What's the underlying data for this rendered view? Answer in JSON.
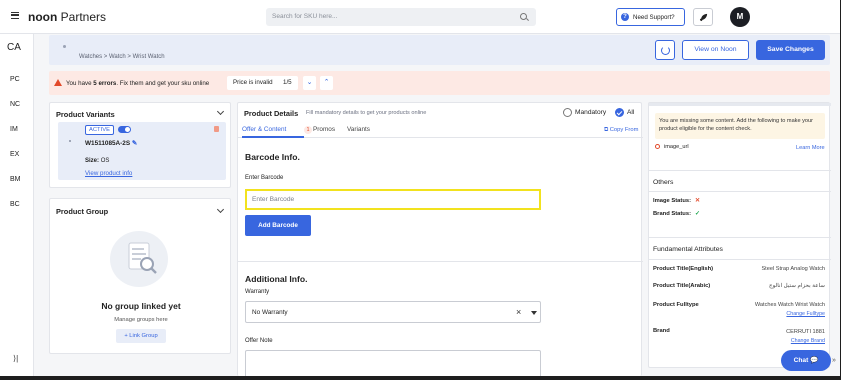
{
  "topbar": {
    "logo_main": "noon",
    "logo_sub": " Partners",
    "search_placeholder": "Search for SKU here...",
    "support_label": "Need Support?",
    "avatar_initial": "M"
  },
  "rail": {
    "items": [
      "CA",
      "PC",
      "NC",
      "IM",
      "EX",
      "BM",
      "BC"
    ],
    "collapse_glyph": "⟩|"
  },
  "actions": {
    "breadcrumb": "Watches > Watch > Wrist Watch",
    "view_on_noon": "View on Noon",
    "save_changes": "Save Changes"
  },
  "errors": {
    "message_pre": "You have ",
    "message_count": "5 errors",
    "message_post": ". Fix them and get your sku online",
    "current_error": "Price is invalid",
    "position": "1/5",
    "prev_glyph": "⌄",
    "next_glyph": "⌃"
  },
  "variants": {
    "title": "Product Variants",
    "status": "ACTIVE",
    "sku": "W1511085A-2S",
    "size_label": "Size:",
    "size_value": "OS",
    "view_info": "View product info"
  },
  "group": {
    "title": "Product Group",
    "empty_title": "No group linked yet",
    "manage_text": "Manage groups here",
    "link_button": "+ Link Group"
  },
  "details": {
    "title": "Product Details",
    "subtitle": "Fill mandatory details to get your products online",
    "filter_mandatory": "Mandatory",
    "filter_all": "All",
    "tabs": [
      "Offer & Content",
      "Promos",
      "Variants"
    ],
    "offer_error_count": "1",
    "copy_from": "Copy From",
    "barcode_section": "Barcode Info.",
    "barcode_label": "Enter Barcode",
    "barcode_placeholder": "Enter Barcode",
    "add_barcode": "Add Barcode",
    "additional_section": "Additional Info.",
    "warranty_label": "Warranty",
    "warranty_value": "No Warranty",
    "offer_note_label": "Offer Note"
  },
  "right_panel": {
    "missing_text": "You are missing some content. Add the following to make your product eligible for the content check.",
    "missing_item": "image_url",
    "learn_more": "Learn More",
    "others_title": "Others",
    "image_status_label": "Image Status:",
    "brand_status_label": "Brand Status:",
    "fundamental_title": "Fundamental Attributes",
    "attributes": [
      {
        "label": "Product Title(English)",
        "value": "Steel Strap Analog Watch"
      },
      {
        "label": "Product Title(Arabic)",
        "value": "ساعة بحزام ستيل انالوج"
      },
      {
        "label": "Product Fulltype",
        "value": "Watches Watch Wrist Watch",
        "link": "Change Fulltype"
      },
      {
        "label": "Brand",
        "value": "CERRUTI 1881",
        "link": "Change Brand"
      }
    ]
  },
  "chat": {
    "label": "Chat 💬",
    "arrow": "»"
  },
  "colors": {
    "accent": "#3866df",
    "error": "#e2492a",
    "success": "#17a34a",
    "highlight": "#f2e21e"
  }
}
